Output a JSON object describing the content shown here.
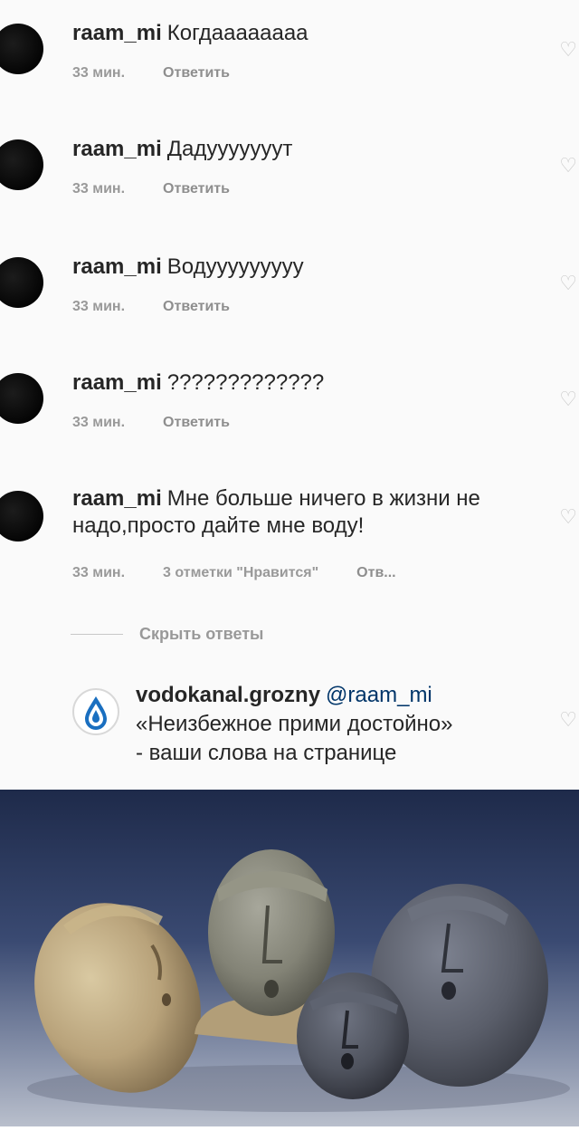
{
  "comments": [
    {
      "username": "raam_mi",
      "text": "Когдааааааaa",
      "time": "33 мин.",
      "reply": "Ответить"
    },
    {
      "username": "raam_mi",
      "text": "Дадууууууут",
      "time": "33 мин.",
      "reply": "Ответить"
    },
    {
      "username": "raam_mi",
      "text": "Водууууууууу",
      "time": "33 мин.",
      "reply": "Ответить"
    },
    {
      "username": "raam_mi",
      "text": "?????????????",
      "time": "33 мин.",
      "reply": "Ответить"
    },
    {
      "username": "raam_mi",
      "text": "Мне больше ничего в жизни не надо,просто дайте мне воду!",
      "time": "33 мин.",
      "likes": "3 отметки \"Нравится\"",
      "reply": "Отв..."
    }
  ],
  "hide_replies": "Скрыть ответы",
  "reply": {
    "username": "vodokanal.grozny",
    "mention": "@raam_mi",
    "line2": "«Неизбежное прими достойно»",
    "line3": "- ваши слова на странице"
  },
  "colors": {
    "username": "#262626",
    "meta": "#999999",
    "mention": "#003569",
    "logo_blue": "#1a6fc0"
  },
  "icons": [
    "heart-icon",
    "vodokanal-logo-icon"
  ]
}
